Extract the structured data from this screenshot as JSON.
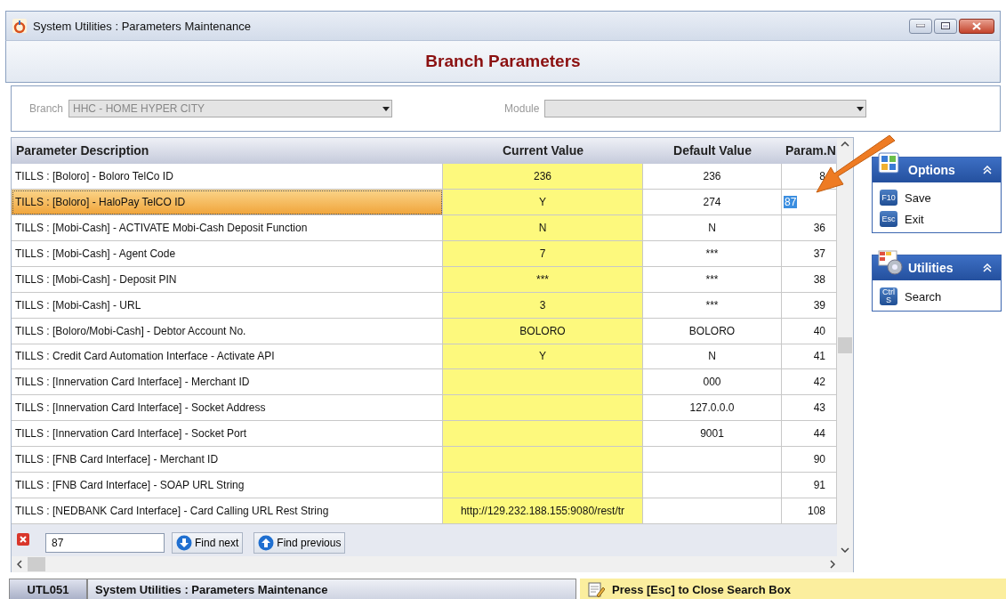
{
  "window": {
    "title": "System Utilities : Parameters Maintenance"
  },
  "header": {
    "title": "Branch Parameters"
  },
  "filters": [
    {
      "label": "Branch",
      "value": "HHC - HOME HYPER CITY",
      "disabled": true
    },
    {
      "label": "Module",
      "disabled": true
    }
  ],
  "grid": {
    "columns": [
      "Parameter Description",
      "Current Value",
      "Default Value",
      "Param.N"
    ],
    "rows": [
      {
        "description": "TILLS : [Boloro] - Boloro TelCo ID",
        "current": "236",
        "default": "236",
        "param": "8",
        "selected": false,
        "match": false
      },
      {
        "description": "TILLS : [Boloro] - HaloPay TelCO ID",
        "current": "Y",
        "default": "274",
        "param": "87",
        "selected": true,
        "match": true
      },
      {
        "description": "TILLS : [Mobi-Cash] - ACTIVATE Mobi-Cash Deposit Function",
        "current": "N",
        "default": "N",
        "param": "36",
        "selected": false,
        "match": false
      },
      {
        "description": "TILLS : [Mobi-Cash] - Agent Code",
        "current": "7",
        "default": "***",
        "param": "37",
        "selected": false,
        "match": false
      },
      {
        "description": "TILLS : [Mobi-Cash] - Deposit PIN",
        "current": "***",
        "default": "***",
        "param": "38",
        "selected": false,
        "match": false
      },
      {
        "description": "TILLS : [Mobi-Cash] - URL",
        "current": "3",
        "default": "***",
        "param": "39",
        "selected": false,
        "match": false
      },
      {
        "description": "TILLS : [Boloro/Mobi-Cash] - Debtor Account No.",
        "current": "BOLORO",
        "default": "BOLORO",
        "param": "40",
        "selected": false,
        "match": false
      },
      {
        "description": "TILLS : Credit Card Automation Interface - Activate API",
        "current": "Y",
        "default": "N",
        "param": "41",
        "selected": false,
        "match": false
      },
      {
        "description": "TILLS : [Innervation Card Interface] - Merchant ID",
        "default": "000",
        "param": "42",
        "selected": false,
        "match": false
      },
      {
        "description": "TILLS : [Innervation Card Interface] - Socket Address",
        "default": "127.0.0.0",
        "param": "43",
        "selected": false,
        "match": false
      },
      {
        "description": "TILLS : [Innervation Card Interface] - Socket Port",
        "default": "9001",
        "param": "44",
        "selected": false,
        "match": false
      },
      {
        "description": "TILLS : [FNB Card Interface] - Merchant ID",
        "param": "90",
        "selected": false,
        "match": false
      },
      {
        "description": "TILLS : [FNB Card Interface] - SOAP URL String",
        "param": "91",
        "selected": false,
        "match": false
      },
      {
        "description": "TILLS : [NEDBANK Card Interface] - Card Calling URL Rest String",
        "current": "http://129.232.188.155:9080/rest/tr",
        "param": "108",
        "selected": false,
        "match": false
      }
    ]
  },
  "search": {
    "value": "87",
    "buttons": [
      {
        "label": "Find next",
        "kind": "next"
      },
      {
        "label": "Find previous",
        "kind": "previous"
      }
    ]
  },
  "side_panels": [
    {
      "title": "Options",
      "kind": "options",
      "expanded": true,
      "items": [
        {
          "key": "F10",
          "label": "Save"
        },
        {
          "key": "Esc",
          "label": "Exit"
        }
      ]
    },
    {
      "title": "Utilities",
      "kind": "utilities",
      "expanded": true,
      "items": [
        {
          "key": "Ctrl S",
          "label": "Search"
        }
      ]
    }
  ],
  "status_bar": {
    "code": "UTL051",
    "title": "System Utilities : Parameters Maintenance",
    "hint": "Press [Esc] to Close Search Box"
  }
}
